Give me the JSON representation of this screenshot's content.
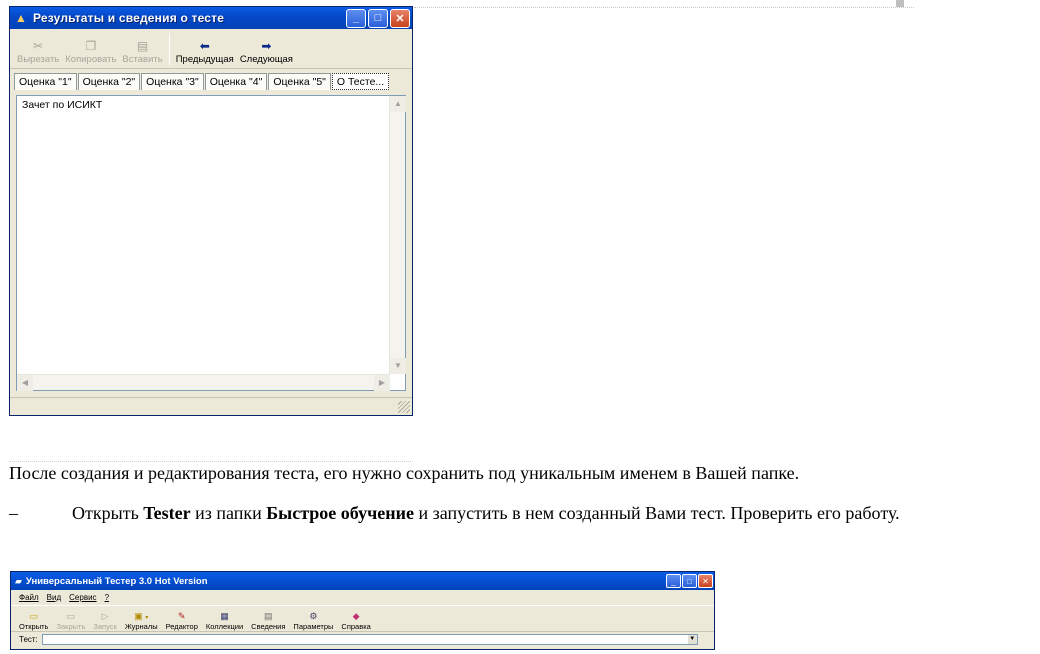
{
  "window1": {
    "title": "Результаты и сведения о тесте",
    "toolbar": [
      {
        "label": "Вырезать",
        "icon": "scissors-icon",
        "glyph": "✂",
        "enabled": false
      },
      {
        "label": "Копировать",
        "icon": "copy-icon",
        "glyph": "❐",
        "enabled": false
      },
      {
        "label": "Вставить",
        "icon": "paste-icon",
        "glyph": "▤",
        "enabled": false
      },
      {
        "label": "Предыдущая",
        "icon": "arrow-left-icon",
        "glyph": "⬅",
        "enabled": true
      },
      {
        "label": "Следующая",
        "icon": "arrow-right-icon",
        "glyph": "➡",
        "enabled": true
      }
    ],
    "tabs": [
      "Оценка \"1\"",
      "Оценка \"2\"",
      "Оценка \"3\"",
      "Оценка \"4\"",
      "Оценка \"5\"",
      "О Тесте..."
    ],
    "active_tab": 5,
    "content_text": "Зачет по ИСИКТ"
  },
  "document": {
    "paragraph1": "После создания и редактирования теста, его нужно сохранить под уникальным именем в Вашей папке.",
    "list_dash": "–",
    "item_prefix": "Открыть ",
    "item_bold1": "Tester",
    "item_mid": " из папки ",
    "item_bold2": "Быстрое обучение",
    "item_suffix": " и запустить в нем созданный Вами тест. Проверить его работу."
  },
  "window2": {
    "title": "Универсальный Тестер 3.0 Hot Version",
    "menu": [
      "Файл",
      "Вид",
      "Сервис",
      "?"
    ],
    "toolbar": [
      {
        "label": "Открыть",
        "icon": "open-folder-icon",
        "glyph": "📂",
        "enabled": true
      },
      {
        "label": "Закрыть",
        "icon": "close-doc-icon",
        "glyph": "▭",
        "enabled": false
      },
      {
        "label": "Запуск",
        "icon": "play-icon",
        "glyph": "▷",
        "enabled": false
      },
      {
        "label": "Журналы",
        "icon": "journal-icon",
        "glyph": "▣",
        "enabled": true
      },
      {
        "label": "Редактор",
        "icon": "editor-icon",
        "glyph": "✎",
        "enabled": true
      },
      {
        "label": "Коллекции",
        "icon": "grid-icon",
        "glyph": "▦",
        "enabled": true
      },
      {
        "label": "Сведения",
        "icon": "info-card-icon",
        "glyph": "▤",
        "enabled": true
      },
      {
        "label": "Параметры",
        "icon": "settings-icon",
        "glyph": "⚙",
        "enabled": true
      },
      {
        "label": "Справка",
        "icon": "help-icon",
        "glyph": "◆",
        "enabled": true
      }
    ],
    "test_label": "Тест:",
    "test_value": ""
  },
  "colors": {
    "titlebar": "#0548c6",
    "window_bg": "#ece9d8",
    "close_button": "#c9421c"
  }
}
